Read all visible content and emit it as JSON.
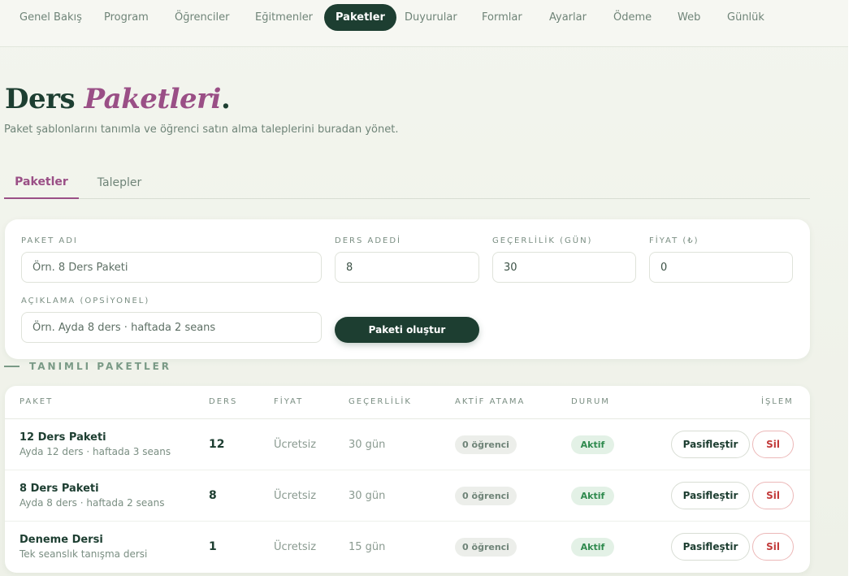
{
  "nav": {
    "items": [
      {
        "label": "Genel Bakış"
      },
      {
        "label": "Program"
      },
      {
        "label": "Öğrenciler"
      },
      {
        "label": "Eğitmenler"
      },
      {
        "label": "Paketler",
        "active": true
      },
      {
        "label": "Duyurular"
      },
      {
        "label": "Formlar"
      },
      {
        "label": "Ayarlar"
      },
      {
        "label": "Ödeme"
      },
      {
        "label": "Web"
      },
      {
        "label": "Günlük"
      }
    ]
  },
  "header": {
    "title_main": "Ders",
    "title_accent": "Paketleri",
    "title_dot": ".",
    "subtitle": "Paket şablonlarını tanımla ve öğrenci satın alma taleplerini buradan yönet."
  },
  "tabs": [
    {
      "label": "Paketler",
      "active": true
    },
    {
      "label": "Talepler"
    }
  ],
  "form": {
    "name_label": "PAKET ADI",
    "name_placeholder": "Örn. 8 Ders Paketi",
    "count_label": "DERS ADEDİ",
    "count_value": "8",
    "validity_label": "GEÇERLİLİK (GÜN)",
    "validity_value": "30",
    "price_label": "FİYAT (₺)",
    "price_value": "0",
    "desc_label": "AÇIKLAMA (OPSİYONEL)",
    "desc_placeholder": "Örn. Ayda 8 ders · haftada 2 seans",
    "create_label": "Paketi oluştur"
  },
  "section": {
    "title": "TANIMLI PAKETLER"
  },
  "table": {
    "headers": {
      "package": "PAKET",
      "lessons": "DERS",
      "price": "FİYAT",
      "validity": "GEÇERLİLİK",
      "active": "AKTİF ATAMA",
      "status": "DURUM",
      "action": "İŞLEM"
    },
    "rows": [
      {
        "name": "12 Ders Paketi",
        "desc": "Ayda 12 ders · haftada 3 seans",
        "lessons": "12",
        "price": "Ücretsiz",
        "validity": "30 gün",
        "assigned": "0 öğrenci",
        "status": "Aktif",
        "deactivate": "Pasifleştir",
        "delete": "Sil"
      },
      {
        "name": "8 Ders Paketi",
        "desc": "Ayda 8 ders · haftada 2 seans",
        "lessons": "8",
        "price": "Ücretsiz",
        "validity": "30 gün",
        "assigned": "0 öğrenci",
        "status": "Aktif",
        "deactivate": "Pasifleştir",
        "delete": "Sil"
      },
      {
        "name": "Deneme Dersi",
        "desc": "Tek seanslık tanışma dersi",
        "lessons": "1",
        "price": "Ücretsiz",
        "validity": "15 gün",
        "assigned": "0 öğrenci",
        "status": "Aktif",
        "deactivate": "Pasifleştir",
        "delete": "Sil"
      }
    ]
  },
  "colors": {
    "primary": "#1d3e31",
    "accent": "#9a4f86",
    "success": "#2f8a4e",
    "danger": "#c23a3a"
  }
}
